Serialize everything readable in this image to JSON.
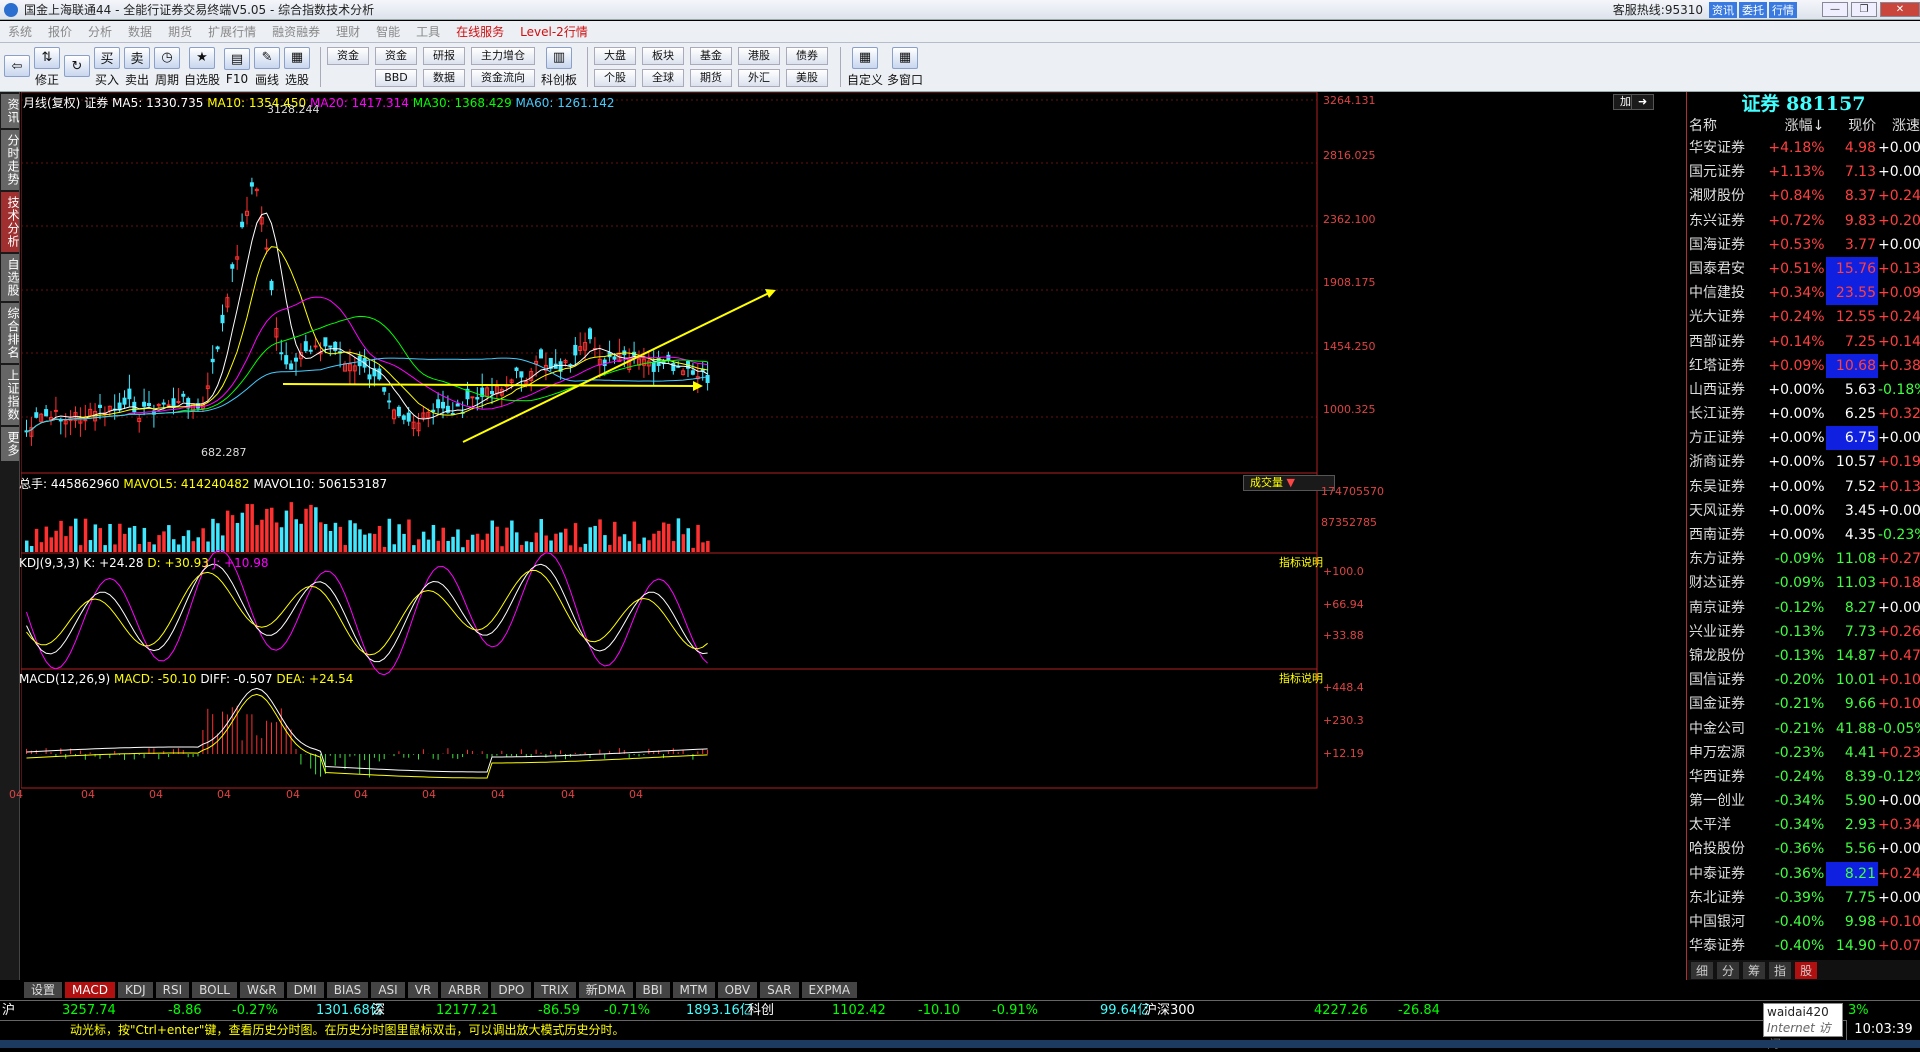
{
  "window": {
    "title": "国金上海联通44 - 全能行证券交易终端V5.05 - 综合指数技术分析",
    "hotline": "客服热线:95310",
    "chips": [
      "资讯",
      "委托",
      "行情"
    ]
  },
  "menu": [
    "系统",
    "报价",
    "分析",
    "数据",
    "期货",
    "扩展行情",
    "融资融券",
    "理财",
    "智能",
    "工具",
    "在线服务",
    "Level-2行情"
  ],
  "toolbar": {
    "big": [
      {
        "label": "",
        "icon": "back-arrow-icon",
        "glyph": "⇦"
      },
      {
        "label": "修正",
        "icon": "up-down-arrows-icon",
        "glyph": "⇅"
      },
      {
        "label": "",
        "icon": "refresh-icon",
        "glyph": "↻"
      },
      {
        "label": "买入",
        "icon": "buy-icon",
        "glyph": "买"
      },
      {
        "label": "卖出",
        "icon": "sell-icon",
        "glyph": "卖"
      },
      {
        "label": "周期",
        "icon": "clock-icon",
        "glyph": "◷"
      },
      {
        "label": "自选股",
        "icon": "star-icon",
        "glyph": "★"
      },
      {
        "label": "F10",
        "icon": "f10-icon",
        "glyph": "▤"
      },
      {
        "label": "画线",
        "icon": "pencil-icon",
        "glyph": "✎"
      },
      {
        "label": "选股",
        "icon": "filter-icon",
        "glyph": "▦"
      }
    ],
    "grp1": [
      "资金",
      "研报",
      "主力增仓",
      "BBD",
      "数据",
      "资金流向"
    ],
    "kcb": "科创板",
    "grp2": [
      "大盘",
      "板块",
      "基金",
      "港股",
      "债券",
      "个股",
      "全球",
      "期货",
      "外汇",
      "美股"
    ],
    "right": [
      "自定义",
      "多窗口"
    ]
  },
  "lefttabs": [
    "资讯",
    "分时走势",
    "技术分析",
    "自选股",
    "综合排名",
    "上证指数",
    "更多"
  ],
  "chart": {
    "header": {
      "period": "月线(复权)",
      "name": "证券",
      "ma5": "MA5: 1330.735",
      "ma10": "MA10: 1354.450",
      "ma20": "MA20: 1417.314",
      "ma30": "MA30: 1368.429",
      "ma60": "MA60: 1261.142"
    },
    "price_axis": [
      "3264.131",
      "2816.025",
      "2362.100",
      "1908.175",
      "1454.250",
      "1000.325"
    ],
    "high_label": "3128.244",
    "low_label": "682.287",
    "vol_header": {
      "total": "总手: 445862960",
      "mavol5": "MAVOL5: 414240482",
      "mavol10": "MAVOL10: 506153187"
    },
    "vol_btn": "成交量",
    "vol_axis": [
      "174705570",
      "87352785"
    ],
    "kdj_header": {
      "name": "KDJ(9,3,3)",
      "k": "K: +24.28",
      "d": "D: +30.93",
      "j": "J: +10.98"
    },
    "kdj_axis": [
      "+100.0",
      "+66.94",
      "+33.88"
    ],
    "macd_header": {
      "name": "MACD(12,26,9)",
      "macd": "MACD: -50.10",
      "diff": "DIFF: -0.507",
      "dea": "DEA: +24.54"
    },
    "macd_axis": [
      "+448.4",
      "+230.3",
      "+12.19"
    ],
    "explain": "指标说明",
    "plus": "加",
    "x_ticks": [
      "04",
      "04",
      "04",
      "04",
      "04",
      "04",
      "04",
      "04",
      "04",
      "04"
    ]
  },
  "indicator_tabs": [
    "设置",
    "MACD",
    "KDJ",
    "RSI",
    "BOLL",
    "W&R",
    "DMI",
    "BIAS",
    "ASI",
    "VR",
    "ARBR",
    "DPO",
    "TRIX",
    "新DMA",
    "BBI",
    "MTM",
    "OBV",
    "SAR",
    "EXPMA"
  ],
  "sector": {
    "title": "证券 881157",
    "cols": [
      "名称",
      "涨幅",
      "现价",
      "涨速"
    ],
    "rows": [
      [
        "华安证券",
        "+4.18%",
        "4.98",
        "+0.00%"
      ],
      [
        "国元证券",
        "+1.13%",
        "7.13",
        "+0.00%"
      ],
      [
        "湘财股份",
        "+0.84%",
        "8.37",
        "+0.24%"
      ],
      [
        "东兴证券",
        "+0.72%",
        "9.83",
        "+0.20%"
      ],
      [
        "国海证券",
        "+0.53%",
        "3.77",
        "+0.00%"
      ],
      [
        "国泰君安",
        "+0.51%",
        "15.76",
        "+0.13%"
      ],
      [
        "中信建投",
        "+0.34%",
        "23.55",
        "+0.09%"
      ],
      [
        "光大证券",
        "+0.24%",
        "12.55",
        "+0.24%"
      ],
      [
        "西部证券",
        "+0.14%",
        "7.25",
        "+0.14%"
      ],
      [
        "红塔证券",
        "+0.09%",
        "10.68",
        "+0.38%"
      ],
      [
        "山西证券",
        "+0.00%",
        "5.63",
        "-0.18%"
      ],
      [
        "长江证券",
        "+0.00%",
        "6.25",
        "+0.32%"
      ],
      [
        "方正证券",
        "+0.00%",
        "6.75",
        "+0.00%"
      ],
      [
        "浙商证券",
        "+0.00%",
        "10.57",
        "+0.19%"
      ],
      [
        "东吴证券",
        "+0.00%",
        "7.52",
        "+0.13%"
      ],
      [
        "天风证券",
        "+0.00%",
        "3.45",
        "+0.00%"
      ],
      [
        "西南证券",
        "+0.00%",
        "4.35",
        "-0.23%"
      ],
      [
        "东方证券",
        "-0.09%",
        "11.08",
        "+0.27%"
      ],
      [
        "财达证券",
        "-0.09%",
        "11.03",
        "+0.18%"
      ],
      [
        "南京证券",
        "-0.12%",
        "8.27",
        "+0.00%"
      ],
      [
        "兴业证券",
        "-0.13%",
        "7.73",
        "+0.26%"
      ],
      [
        "锦龙股份",
        "-0.13%",
        "14.87",
        "+0.47%"
      ],
      [
        "国信证券",
        "-0.20%",
        "10.01",
        "+0.10%"
      ],
      [
        "国金证券",
        "-0.21%",
        "9.66",
        "+0.10%"
      ],
      [
        "中金公司",
        "-0.21%",
        "41.88",
        "-0.05%"
      ],
      [
        "申万宏源",
        "-0.23%",
        "4.41",
        "+0.23%"
      ],
      [
        "华西证券",
        "-0.24%",
        "8.39",
        "-0.12%"
      ],
      [
        "第一创业",
        "-0.34%",
        "5.90",
        "+0.00%"
      ],
      [
        "太平洋",
        "-0.34%",
        "2.93",
        "+0.34%"
      ],
      [
        "哈投股份",
        "-0.36%",
        "5.56",
        "+0.00%"
      ],
      [
        "中泰证券",
        "-0.36%",
        "8.21",
        "+0.24%"
      ],
      [
        "东北证券",
        "-0.39%",
        "7.75",
        "+0.00%"
      ],
      [
        "中国银河",
        "-0.40%",
        "9.98",
        "+0.10%"
      ],
      [
        "华泰证券",
        "-0.40%",
        "14.90",
        "+0.07%"
      ]
    ],
    "highlight": [
      5,
      6,
      9,
      12,
      30
    ],
    "tabs": [
      "细",
      "分",
      "筹",
      "指",
      "股"
    ]
  },
  "status": {
    "sh": "沪",
    "sh_val": "3257.74",
    "sh_chg": "-8.86",
    "sh_pct": "-0.27%",
    "sh_amt": "1301.68亿",
    "sz": "深",
    "sz_val": "12177.21",
    "sz_chg": "-86.59",
    "sz_pct": "-0.71%",
    "sz_amt": "1893.16亿",
    "kc": "科创",
    "kc_val": "1102.42",
    "kc_chg": "-10.10",
    "kc_pct": "-0.91%",
    "kc_amt": "99.64亿",
    "hs": "沪深300",
    "hs_val": "4227.26",
    "hs_chg": "-26.84",
    "hs_pct": "3%"
  },
  "ticker": "动光标，按\"Ctrl+enter\"键，查看历史分时图。在历史分时图里鼠标双击，可以调出放大模式历史分时。",
  "tip": {
    "l1": "waidai420",
    "l2": "Internet 访问"
  },
  "clock": "10:03:39"
}
